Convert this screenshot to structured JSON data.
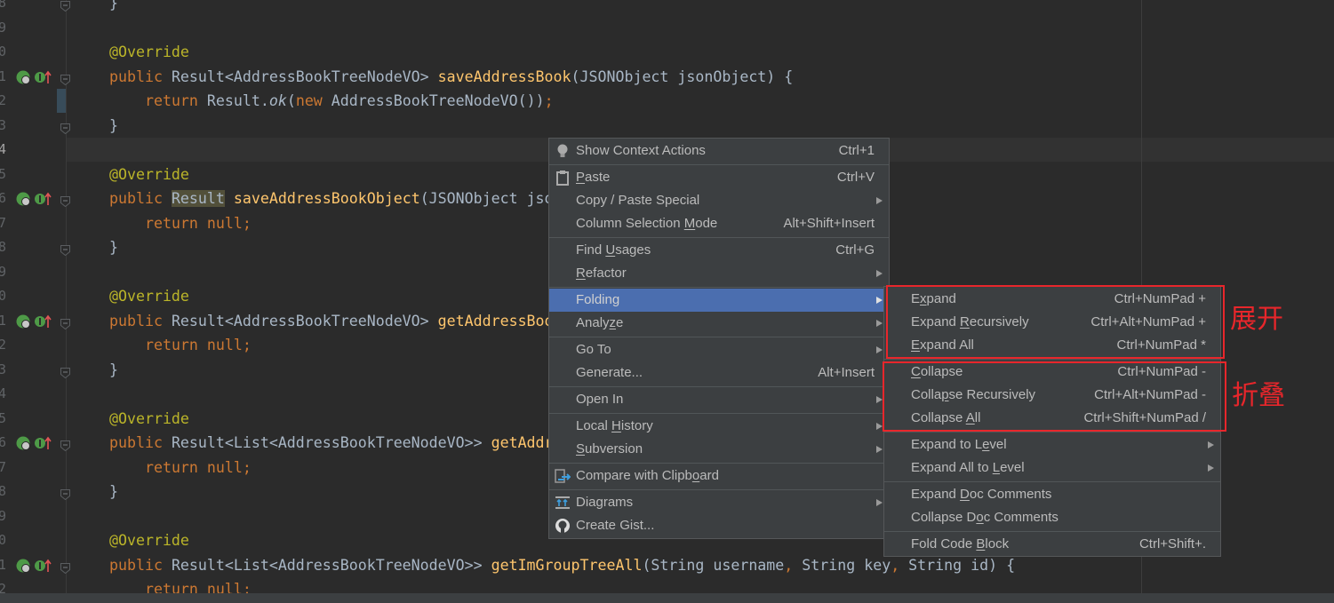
{
  "editor": {
    "current_line_index": 6,
    "line_digits": [
      "8",
      "9",
      "0",
      "1",
      "2",
      "3",
      "4",
      "5",
      "6",
      "7",
      "8",
      "9",
      "0",
      "1",
      "2",
      "3",
      "4",
      "5",
      "6",
      "7",
      "8",
      "9",
      "0",
      "1",
      "2"
    ],
    "gutter_icon_lines": [
      3,
      8,
      13,
      18,
      23
    ],
    "fold_lines": [
      0,
      3,
      5,
      8,
      10,
      13,
      15,
      18,
      20,
      23
    ],
    "lines": [
      [
        {
          "c": "ty",
          "t": "}"
        }
      ],
      [],
      [
        {
          "c": "an",
          "t": "@Override"
        }
      ],
      [
        {
          "c": "kw",
          "t": "public "
        },
        {
          "c": "ty",
          "t": "Result<AddressBookTreeNodeVO> "
        },
        {
          "c": "fn",
          "t": "saveAddressBook"
        },
        {
          "c": "ty",
          "t": "(JSONObject jsonObject) {"
        }
      ],
      [
        {
          "c": "ty",
          "t": "    "
        },
        {
          "c": "kw",
          "t": "return "
        },
        {
          "c": "ty",
          "t": "Result."
        },
        {
          "c": "it",
          "t": "ok"
        },
        {
          "c": "ty",
          "t": "("
        },
        {
          "c": "kw",
          "t": "new "
        },
        {
          "c": "ty",
          "t": "AddressBookTreeNodeVO())"
        },
        {
          "c": "kw",
          "t": ";"
        }
      ],
      [
        {
          "c": "ty",
          "t": "}"
        }
      ],
      [],
      [
        {
          "c": "an",
          "t": "@Override"
        }
      ],
      [
        {
          "c": "kw",
          "t": "public "
        },
        {
          "c": "hl",
          "t": "Result"
        },
        {
          "c": "ty",
          "t": " "
        },
        {
          "c": "fn",
          "t": "saveAddressBookObject"
        },
        {
          "c": "ty",
          "t": "(JSONObject jso"
        }
      ],
      [
        {
          "c": "ty",
          "t": "    "
        },
        {
          "c": "kw",
          "t": "return null;"
        }
      ],
      [
        {
          "c": "ty",
          "t": "}"
        }
      ],
      [],
      [
        {
          "c": "an",
          "t": "@Override"
        }
      ],
      [
        {
          "c": "kw",
          "t": "public "
        },
        {
          "c": "ty",
          "t": "Result<AddressBookTreeNodeVO> "
        },
        {
          "c": "fn",
          "t": "getAddressBoo"
        }
      ],
      [
        {
          "c": "ty",
          "t": "    "
        },
        {
          "c": "kw",
          "t": "return null;"
        }
      ],
      [
        {
          "c": "ty",
          "t": "}"
        }
      ],
      [],
      [
        {
          "c": "an",
          "t": "@Override"
        }
      ],
      [
        {
          "c": "kw",
          "t": "public "
        },
        {
          "c": "ty",
          "t": "Result<List<AddressBookTreeNodeVO>> "
        },
        {
          "c": "fn",
          "t": "getAddr"
        }
      ],
      [
        {
          "c": "ty",
          "t": "    "
        },
        {
          "c": "kw",
          "t": "return null;"
        }
      ],
      [
        {
          "c": "ty",
          "t": "}"
        }
      ],
      [],
      [
        {
          "c": "an",
          "t": "@Override"
        }
      ],
      [
        {
          "c": "kw",
          "t": "public "
        },
        {
          "c": "ty",
          "t": "Result<List<AddressBookTreeNodeVO>> "
        },
        {
          "c": "fn",
          "t": "getImGroupTreeAll"
        },
        {
          "c": "ty",
          "t": "(String username"
        },
        {
          "c": "kw",
          "t": ", "
        },
        {
          "c": "ty",
          "t": "String key"
        },
        {
          "c": "kw",
          "t": ", "
        },
        {
          "c": "ty",
          "t": "String id) {"
        }
      ],
      [
        {
          "c": "ty",
          "t": "    "
        },
        {
          "c": "kw",
          "t": "return null;"
        }
      ]
    ]
  },
  "context_menu": {
    "items": [
      {
        "label": "Show Context Actions",
        "shortcut": "Ctrl+1",
        "icon": "lightbulb-icon"
      },
      {
        "sep": true
      },
      {
        "label": "Paste",
        "mn": 0,
        "shortcut": "Ctrl+V",
        "icon": "clipboard-icon"
      },
      {
        "label": "Copy / Paste Special",
        "submenu": true
      },
      {
        "label": "Column Selection Mode",
        "mn": 17,
        "shortcut": "Alt+Shift+Insert"
      },
      {
        "sep": true
      },
      {
        "label": "Find Usages",
        "mn": 5,
        "shortcut": "Ctrl+G"
      },
      {
        "label": "Refactor",
        "mn": 0,
        "submenu": true
      },
      {
        "sep": true
      },
      {
        "label": "Folding",
        "submenu": true,
        "selected": true
      },
      {
        "label": "Analyze",
        "mn": 5,
        "submenu": true
      },
      {
        "sep": true
      },
      {
        "label": "Go To",
        "submenu": true
      },
      {
        "label": "Generate...",
        "shortcut": "Alt+Insert"
      },
      {
        "sep": true
      },
      {
        "label": "Open In",
        "submenu": true
      },
      {
        "sep": true
      },
      {
        "label": "Local History",
        "mn": 6,
        "submenu": true
      },
      {
        "label": "Subversion",
        "mn": 0,
        "submenu": true
      },
      {
        "sep": true
      },
      {
        "label": "Compare with Clipboard",
        "mn": 18,
        "icon": "compare-clipboard-icon"
      },
      {
        "sep": true
      },
      {
        "label": "Diagrams",
        "submenu": true,
        "icon": "diagrams-icon"
      },
      {
        "label": "Create Gist...",
        "icon": "github-icon"
      }
    ]
  },
  "folding_submenu": {
    "items": [
      {
        "label": "Expand",
        "mn": 1,
        "shortcut": "Ctrl+NumPad +"
      },
      {
        "label": "Expand Recursively",
        "mn": 7,
        "shortcut": "Ctrl+Alt+NumPad +"
      },
      {
        "label": "Expand All",
        "mn": 0,
        "shortcut": "Ctrl+NumPad *"
      },
      {
        "sep": true
      },
      {
        "label": "Collapse",
        "mn": 0,
        "shortcut": "Ctrl+NumPad -"
      },
      {
        "label": "Collapse Recursively",
        "mn": 5,
        "shortcut": "Ctrl+Alt+NumPad -"
      },
      {
        "label": "Collapse All",
        "mn": 9,
        "shortcut": "Ctrl+Shift+NumPad /"
      },
      {
        "sep": true
      },
      {
        "label": "Expand to Level",
        "mn": 11,
        "submenu": true
      },
      {
        "label": "Expand All to Level",
        "mn": 14,
        "submenu": true
      },
      {
        "sep": true
      },
      {
        "label": "Expand Doc Comments",
        "mn": 7
      },
      {
        "label": "Collapse Doc Comments",
        "mn": 10
      },
      {
        "sep": true
      },
      {
        "label": "Fold Code Block",
        "mn": 10,
        "shortcut": "Ctrl+Shift+."
      }
    ]
  },
  "annotations": {
    "expand_note": "展开",
    "collapse_note": "折叠",
    "color": "#e8262b"
  },
  "colors": {
    "menu_bg": "#3c3f41",
    "selection": "#4b6eaf",
    "editor_bg": "#2b2b2b"
  }
}
